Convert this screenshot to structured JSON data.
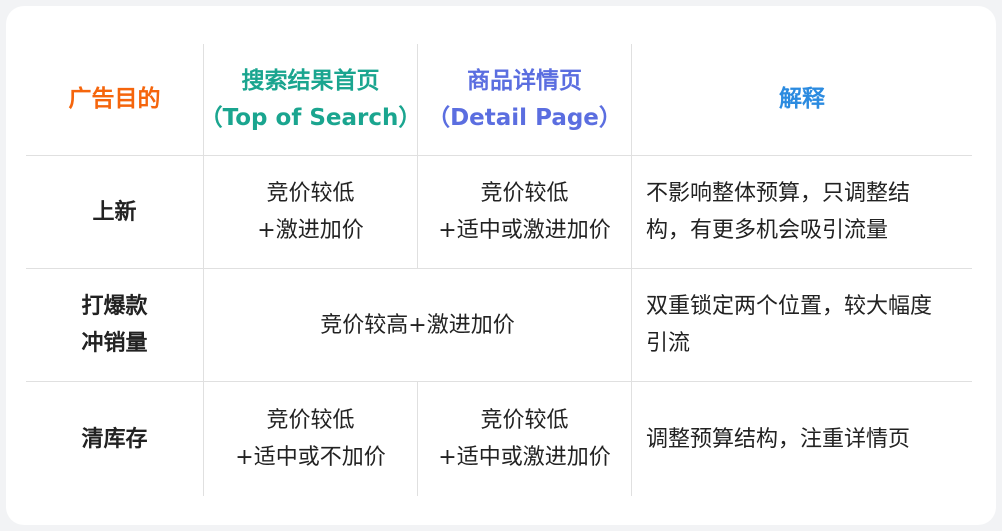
{
  "colors": {
    "goal_header": "#f5650c",
    "search_header": "#1aa58f",
    "detail_header": "#5b6ee0",
    "explain_header": "#2b8be0",
    "body_text": "#222222",
    "divider": "#e0e0e0"
  },
  "table": {
    "headers": {
      "goal": "广告目的",
      "search": [
        "搜索结果首页",
        "（Top of Search）"
      ],
      "detail": [
        "商品详情页",
        "（Detail Page）"
      ],
      "explain": "解释"
    },
    "rows": [
      {
        "goal": [
          "上新"
        ],
        "search": [
          "竞价较低",
          "+激进加价"
        ],
        "detail": [
          "竞价较低",
          "+适中或激进加价"
        ],
        "explain": [
          "不影响整体预算，只调整结",
          "构，有更多机会吸引流量"
        ]
      },
      {
        "goal": [
          "打爆款",
          "冲销量"
        ],
        "merged": "竞价较高+激进加价",
        "explain": [
          "双重锁定两个位置，较大幅度",
          "引流"
        ]
      },
      {
        "goal": [
          "清库存"
        ],
        "search": [
          "竞价较低",
          "+适中或不加价"
        ],
        "detail": [
          "竞价较低",
          "+适中或激进加价"
        ],
        "explain": [
          "调整预算结构，注重详情页"
        ]
      }
    ]
  }
}
